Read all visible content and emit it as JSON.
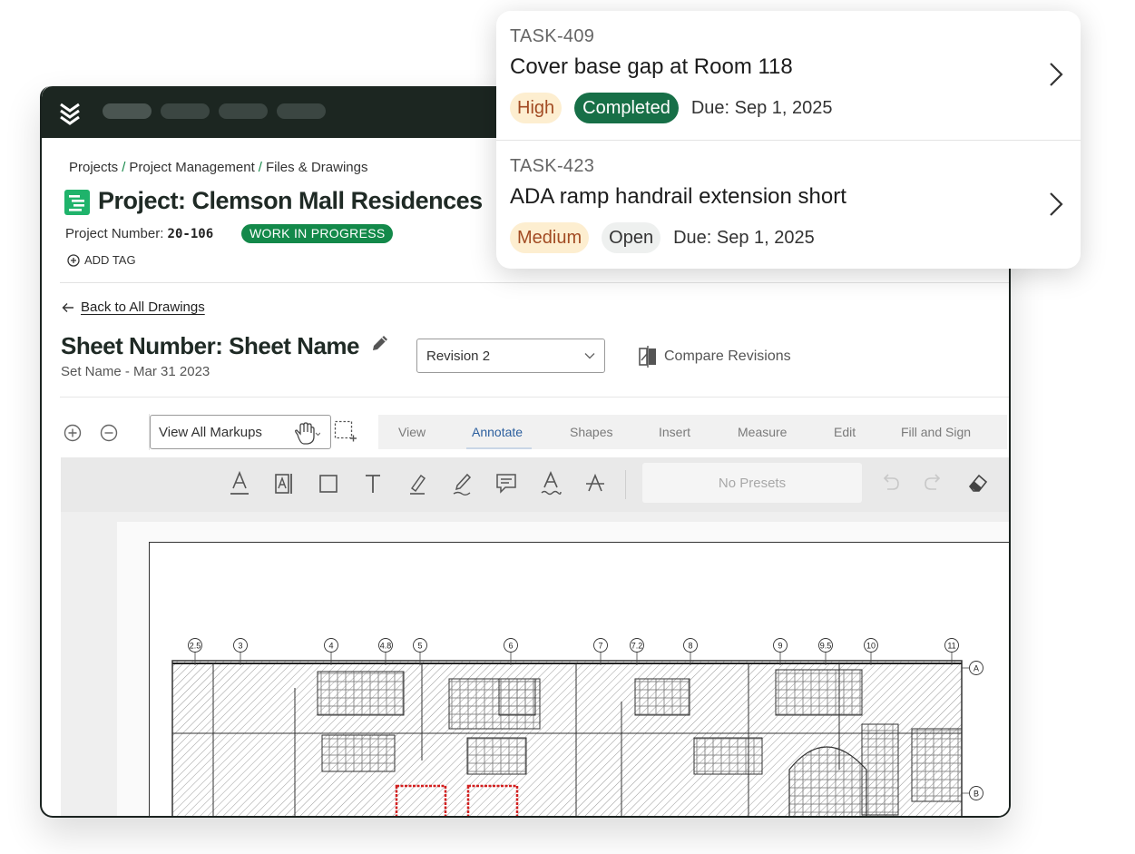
{
  "breadcrumb": {
    "items": [
      "Projects",
      "Project Management",
      "Files & Drawings"
    ],
    "separator": "/"
  },
  "project": {
    "title": "Project: Clemson Mall Residences",
    "number_label": "Project Number:",
    "number": "20-106",
    "status": "WORK IN PROGRESS",
    "add_tag": "ADD TAG"
  },
  "drawing": {
    "back_link": "Back to All Drawings",
    "sheet_title": "Sheet Number: Sheet Name",
    "set_name": "Set Name -",
    "set_date": "Mar 31 2023",
    "revision": "Revision 2",
    "compare_label": "Compare Revisions"
  },
  "toolbar": {
    "markups": "View All Markups",
    "tabs": [
      "View",
      "Annotate",
      "Shapes",
      "Insert",
      "Measure",
      "Edit",
      "Fill and Sign"
    ],
    "active_tab": "Annotate",
    "presets": "No Presets"
  },
  "floorplan": {
    "grid_labels": [
      "2.5",
      "3",
      "4",
      "4.8",
      "5",
      "6",
      "7",
      "7.2",
      "8",
      "9",
      "9.5",
      "10",
      "11"
    ],
    "row_labels": [
      "A",
      "B"
    ]
  },
  "tasks": [
    {
      "id": "TASK-409",
      "title": "Cover base gap at Room 118",
      "priority": "High",
      "status": "Completed",
      "due": "Due: Sep 1, 2025"
    },
    {
      "id": "TASK-423",
      "title": "ADA ramp handrail extension short",
      "priority": "Medium",
      "status": "Open",
      "due": "Due: Sep 1, 2025"
    }
  ],
  "colors": {
    "topbar": "#1c2621",
    "brand_green": "#13894a",
    "completed_green": "#176f47",
    "priority_bg": "#fdeed0",
    "priority_text": "#a24b23",
    "active_tab": "#2c5f9e"
  }
}
